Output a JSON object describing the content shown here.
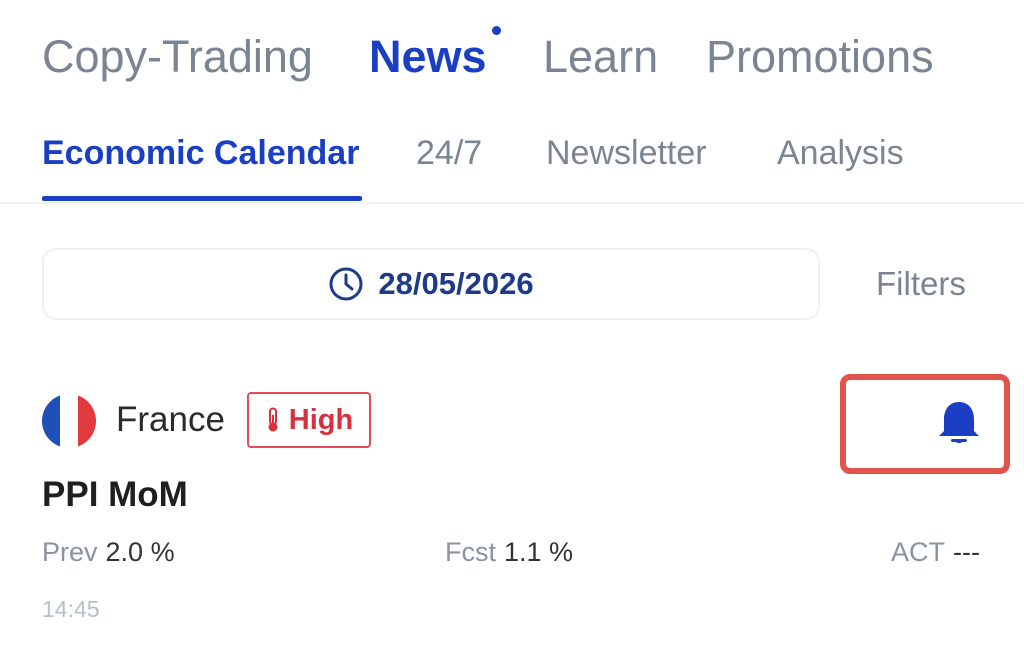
{
  "top_nav": {
    "tabs": [
      {
        "label": "Copy-Trading"
      },
      {
        "label": "News"
      },
      {
        "label": "Learn"
      },
      {
        "label": "Promotions"
      }
    ]
  },
  "sub_nav": {
    "tabs": [
      {
        "label": "Economic Calendar"
      },
      {
        "label": "24/7"
      },
      {
        "label": "Newsletter"
      },
      {
        "label": "Analysis"
      }
    ]
  },
  "date_picker": {
    "value": "28/05/2026",
    "icon": "clock-icon"
  },
  "filters_label": "Filters",
  "event": {
    "country": "France",
    "importance": "High",
    "title": "PPI MoM",
    "prev_label": "Prev",
    "prev_value": "2.0 %",
    "fcst_label": "Fcst",
    "fcst_value": "1.1 %",
    "act_label": "ACT",
    "act_value": "---",
    "time": "14:45"
  },
  "colors": {
    "accent": "#1a3fc4",
    "muted": "#7a8493",
    "danger": "#d9303f",
    "highlight_border": "#e2534b"
  }
}
